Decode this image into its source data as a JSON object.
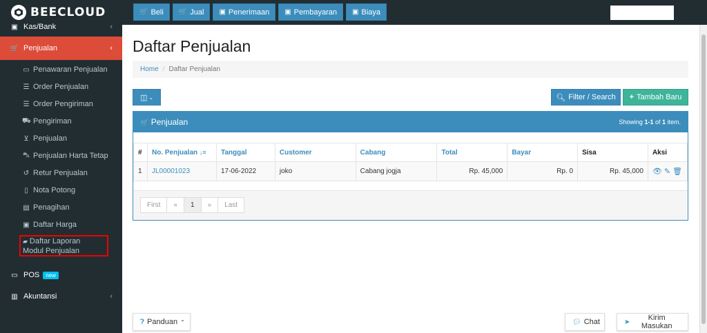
{
  "brand": {
    "name": "BEECLOUD"
  },
  "topnav": [
    {
      "label": "Beli",
      "icon": "cart-icon"
    },
    {
      "label": "Jual",
      "icon": "cart-icon"
    },
    {
      "label": "Penerimaan",
      "icon": "money-icon"
    },
    {
      "label": "Pembayaran",
      "icon": "money-icon"
    },
    {
      "label": "Biaya",
      "icon": "money-icon"
    }
  ],
  "sidebar": {
    "kas_bank": "Kas/Bank",
    "penjualan": "Penjualan",
    "items": [
      "Penawaran Penjualan",
      "Order Penjualan",
      "Order Pengiriman",
      "Pengiriman",
      "Penjualan",
      "Penjualan Harta Tetap",
      "Retur Penjualan",
      "Nota Potong",
      "Penagihan",
      "Daftar Harga",
      "Daftar Laporan Modul Penjualan"
    ],
    "pos": "POS",
    "pos_badge": "new",
    "akuntansi": "Akuntansi"
  },
  "page": {
    "title": "Daftar Penjualan",
    "breadcrumb_home": "Home",
    "breadcrumb_current": "Daftar Penjualan",
    "filter_label": "Filter / Search",
    "add_label": "Tambah Baru"
  },
  "panel": {
    "title": "Penjualan",
    "showing_prefix": "Showing ",
    "showing_range": "1-1",
    "showing_mid": " of ",
    "showing_total": "1",
    "showing_suffix": " item."
  },
  "table": {
    "headers": {
      "no": "#",
      "no_penjualan": "No. Penjualan",
      "tanggal": "Tanggal",
      "customer": "Customer",
      "cabang": "Cabang",
      "total": "Total",
      "bayar": "Bayar",
      "sisa": "Sisa",
      "aksi": "Aksi"
    },
    "rows": [
      {
        "no": "1",
        "no_penjualan": "JL00001023",
        "tanggal": "17-06-2022",
        "customer": "joko",
        "cabang": "Cabang jogja",
        "total": "Rp. 45,000",
        "bayar": "Rp. 0",
        "sisa": "Rp. 45,000"
      }
    ]
  },
  "pager": {
    "first": "First",
    "prev": "«",
    "current": "1",
    "next": "»",
    "last": "Last"
  },
  "footer": {
    "panduan": "Panduan",
    "chat": "Chat",
    "kirim": "Kirim Masukan"
  },
  "colors": {
    "primary": "#3c8dbc",
    "sidebar": "#222d32",
    "active": "#dd4b39",
    "success": "#3eb49b"
  }
}
